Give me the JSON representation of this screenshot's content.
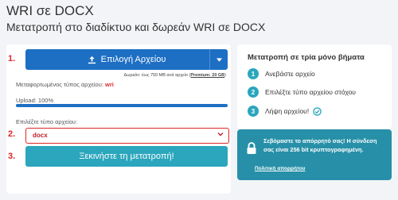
{
  "header": {
    "title": "WRI σε DOCX",
    "subtitle": "Μετατροπή στο διαδίκτυο και δωρεάν WRI σε DOCX"
  },
  "converter": {
    "step1": "1.",
    "step2": "2.",
    "step3": "3.",
    "upload_label": "Επιλογή Αρχείου",
    "limit_note": "Δωρεάν: έως 750 MB ανά αρχείο (",
    "limit_premium": "Premium: 20 GB",
    "limit_close": ")",
    "converted_type_label": "Μεταφορτωμένος τύπος αρχείου:",
    "converted_type_value": "wri",
    "upload_status": "Upload: 100%",
    "upload_progress": 100,
    "choose_type_label": "Επιλέξτε τύπο αρχείου:",
    "selected_format": "docx",
    "convert_label": "Ξεκινήστε τη μετατροπή!"
  },
  "steps_panel": {
    "title": "Μετατροπή σε τρία μόνο βήματα",
    "steps": [
      {
        "num": "1",
        "text": "Ανεβάστε αρχείο"
      },
      {
        "num": "2",
        "text": "Επιλέξτε τύπο αρχείου στόχου"
      },
      {
        "num": "3",
        "text": "Λήψη αρχείου!"
      }
    ]
  },
  "security": {
    "text": "Σεβόμαστε το απόρρητό σας! Η σύνδεση σας είναι 256 bit κρυπτογραφημένη.",
    "link": "Πολιτική απορρήτου"
  },
  "colors": {
    "primary": "#1d6fc4",
    "accent": "#2ba6bc",
    "security_bg": "#2790a8",
    "step_number": "#e02626"
  },
  "icons": {
    "upload": "upload-icon",
    "caret": "caret-down-icon",
    "select_chevron": "chevron-down-icon",
    "check": "check-circle-icon",
    "lock": "lock-icon"
  }
}
